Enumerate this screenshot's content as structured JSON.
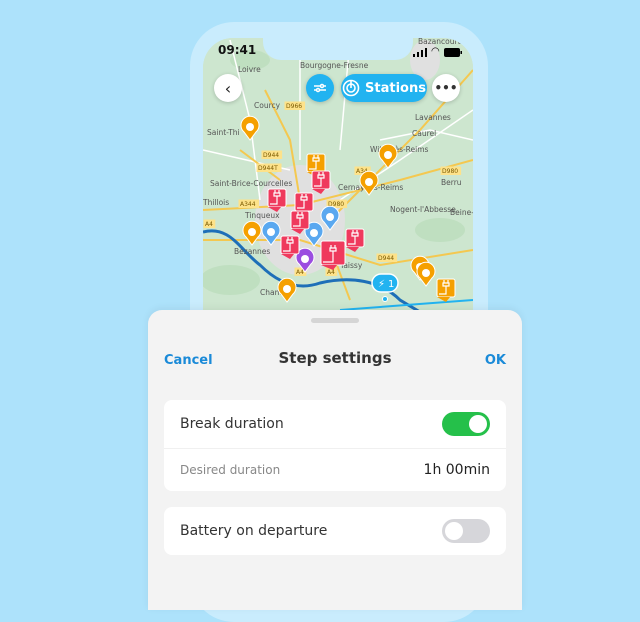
{
  "status_bar": {
    "time": "09:41"
  },
  "map": {
    "labels": [
      "Bazancourt",
      "Loivre",
      "Bourgogne-Fresne",
      "Courcy",
      "D966",
      "Lavannes",
      "Saint-Thi",
      "Caurel",
      "Witry-lès-Reims",
      "D944",
      "D944T",
      "A34",
      "D980",
      "Berru",
      "Saint-Brice-Courcelles",
      "Cernay-lès-Reims",
      "Thillois",
      "A344",
      "D980",
      "Nogent-l'Abbesse",
      "Beine-",
      "Tinqueux",
      "A4",
      "Bezannes",
      "D944",
      "Taissy",
      "Champ",
      "A4",
      "A4"
    ],
    "route_badge": "1",
    "colors": {
      "orange": "#f5a000",
      "red": "#ef3a5d",
      "blue": "#5aa8f0",
      "purple": "#9b4de0",
      "route": "#1e6fb8",
      "water": "#22b3f0"
    }
  },
  "map_controls": {
    "back_icon": "chevron-left",
    "filter_icon": "sliders",
    "stations_label": "Stations",
    "more_icon": "ellipsis"
  },
  "sheet": {
    "cancel": "Cancel",
    "title": "Step settings",
    "ok": "OK",
    "break_duration": {
      "label": "Break duration",
      "enabled": true
    },
    "desired_duration": {
      "label": "Desired duration",
      "value": "1h 00min"
    },
    "battery_on_departure": {
      "label": "Battery on departure",
      "enabled": false
    },
    "colors": {
      "accent": "#1a8ad8",
      "toggle_on": "#25c04a",
      "toggle_off": "#d6d6da"
    }
  }
}
